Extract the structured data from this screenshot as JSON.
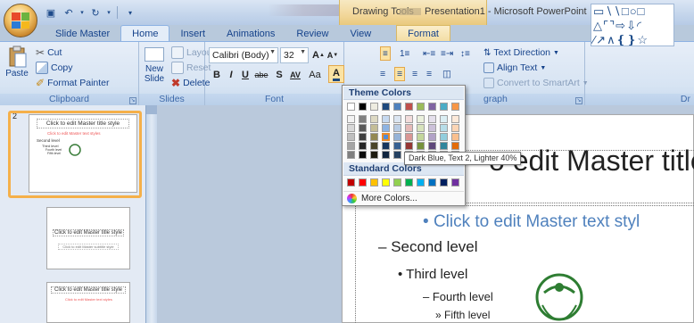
{
  "window": {
    "app_title": "Presentation1 - Microsoft PowerPoint",
    "context_tab_group": "Drawing Tools"
  },
  "tabs": [
    {
      "label": "Slide Master"
    },
    {
      "label": "Home"
    },
    {
      "label": "Insert"
    },
    {
      "label": "Animations"
    },
    {
      "label": "Review"
    },
    {
      "label": "View"
    },
    {
      "label": "Format"
    }
  ],
  "ribbon": {
    "clipboard": {
      "paste": "Paste",
      "cut": "Cut",
      "copy": "Copy",
      "format_painter": "Format Painter",
      "label": "Clipboard"
    },
    "slides": {
      "new_slide": "New Slide",
      "layout": "Layout",
      "reset": "Reset",
      "delete": "Delete",
      "label": "Slides"
    },
    "font": {
      "name": "Calibri (Body)",
      "size": "32",
      "label": "Font",
      "bold": "B",
      "italic": "I",
      "underline": "U",
      "strike": "abe",
      "shadow": "S",
      "spacing": "AV",
      "case": "Aa",
      "font_color": "A"
    },
    "paragraph": {
      "text_direction": "Text Direction",
      "align_text": "Align Text",
      "convert_smartart": "Convert to SmartArt",
      "label": "graph"
    },
    "drawing": {
      "label": "Dr"
    }
  },
  "dropdown": {
    "theme_colors_label": "Theme Colors",
    "standard_colors_label": "Standard Colors",
    "more_colors_label": "More Colors...",
    "tooltip": "Dark Blue, Text 2, Lighter 40%",
    "theme_top": [
      "#ffffff",
      "#000000",
      "#eeece1",
      "#1f497d",
      "#4f81bd",
      "#c0504d",
      "#9bbb59",
      "#8064a2",
      "#4bacc6",
      "#f79646"
    ],
    "theme_shades": [
      [
        "#f2f2f2",
        "#7f7f7f",
        "#ddd9c3",
        "#c6d9f0",
        "#dbe5f1",
        "#f2dcdb",
        "#ebf1dd",
        "#e5e0ec",
        "#dbeef3",
        "#fdeada"
      ],
      [
        "#d8d8d8",
        "#595959",
        "#c4bd97",
        "#8db3e2",
        "#b8cce4",
        "#e5b9b7",
        "#d7e3bc",
        "#ccc1d9",
        "#b7dde8",
        "#fbd5b5"
      ],
      [
        "#bfbfbf",
        "#3f3f3f",
        "#938953",
        "#548dd4",
        "#95b3d7",
        "#d99694",
        "#c3d69b",
        "#b2a2c7",
        "#92cddc",
        "#fac08f"
      ],
      [
        "#a5a5a5",
        "#262626",
        "#494429",
        "#17365d",
        "#366092",
        "#953734",
        "#76923c",
        "#5f497a",
        "#31859b",
        "#e36c09"
      ],
      [
        "#7f7f7f",
        "#0c0c0c",
        "#1d1b10",
        "#0f243e",
        "#244061",
        "#632423",
        "#4f6128",
        "#3f3151",
        "#205867",
        "#974806"
      ]
    ],
    "standard": [
      "#c00000",
      "#ff0000",
      "#ffc000",
      "#ffff00",
      "#92d050",
      "#00b050",
      "#00b0f0",
      "#0070c0",
      "#002060",
      "#7030a0"
    ]
  },
  "slides_pane": {
    "slide_number": "2",
    "thumb_title": "Click to edit Master title style",
    "thumb_text": "Click to edit Master text styles",
    "thumb_levels": [
      "Second level",
      "Third level",
      "Fourth level",
      "Fifth level"
    ],
    "thumb_subtitle": "Click to edit Master subtitle style"
  },
  "slide": {
    "title": "o edit Master title",
    "level1": "Click to edit Master text styl",
    "level2": "Second level",
    "level3": "Third level",
    "level4": "Fourth level",
    "level5": "Fifth level"
  }
}
